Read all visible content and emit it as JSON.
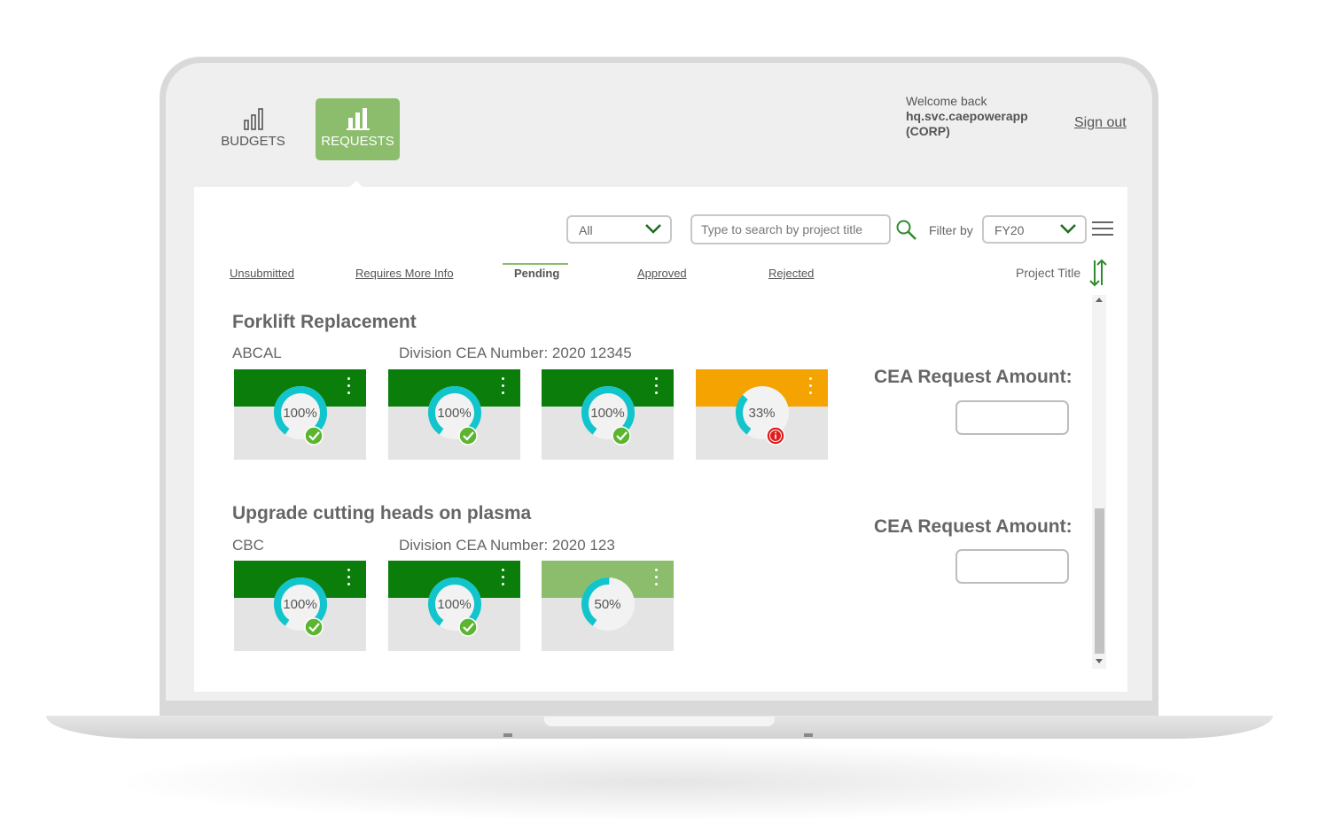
{
  "nav": {
    "budgets_label": "BUDGETS",
    "requests_label": "REQUESTS"
  },
  "user": {
    "welcome": "Welcome back",
    "username": "hq.svc.caepowerapp",
    "domain": "(CORP)",
    "signout": "Sign out"
  },
  "toolbar": {
    "status_select": "All",
    "search_placeholder": "Type to search by project title",
    "filter_label": "Filter by",
    "fiscal_year_select": "FY20"
  },
  "status_tabs": [
    "Unsubmitted",
    "Requires More Info",
    "Pending",
    "Approved",
    "Rejected"
  ],
  "active_status_tab": "Pending",
  "sort": {
    "label": "Project Title"
  },
  "colors": {
    "accent": "#8bbd6c",
    "complete": "#0a7d0a",
    "warning": "#f4a300",
    "progress": "#8bbd6c",
    "donut": "#12c4cc",
    "check": "#5cb531",
    "alert": "#e01e1e"
  },
  "projects": [
    {
      "title": "Forklift Replacement",
      "division": "ABCAL",
      "cea_number": "Division CEA Number: 2020 12345",
      "amount_label": "CEA Request Amount:",
      "amount_value": "",
      "cards": [
        {
          "pct": "100%",
          "value": 100,
          "band": "complete",
          "badge": "check"
        },
        {
          "pct": "100%",
          "value": 100,
          "band": "complete",
          "badge": "check"
        },
        {
          "pct": "100%",
          "value": 100,
          "band": "complete",
          "badge": "check"
        },
        {
          "pct": "33%",
          "value": 33,
          "band": "warning",
          "badge": "alert"
        }
      ]
    },
    {
      "title": "Upgrade cutting heads on plasma",
      "division": "CBC",
      "cea_number": "Division CEA Number: 2020 123",
      "amount_label": "CEA Request Amount:",
      "amount_value": "",
      "cards": [
        {
          "pct": "100%",
          "value": 100,
          "band": "complete",
          "badge": "check"
        },
        {
          "pct": "100%",
          "value": 100,
          "band": "complete",
          "badge": "check"
        },
        {
          "pct": "50%",
          "value": 50,
          "band": "progress",
          "badge": "none"
        }
      ]
    }
  ]
}
